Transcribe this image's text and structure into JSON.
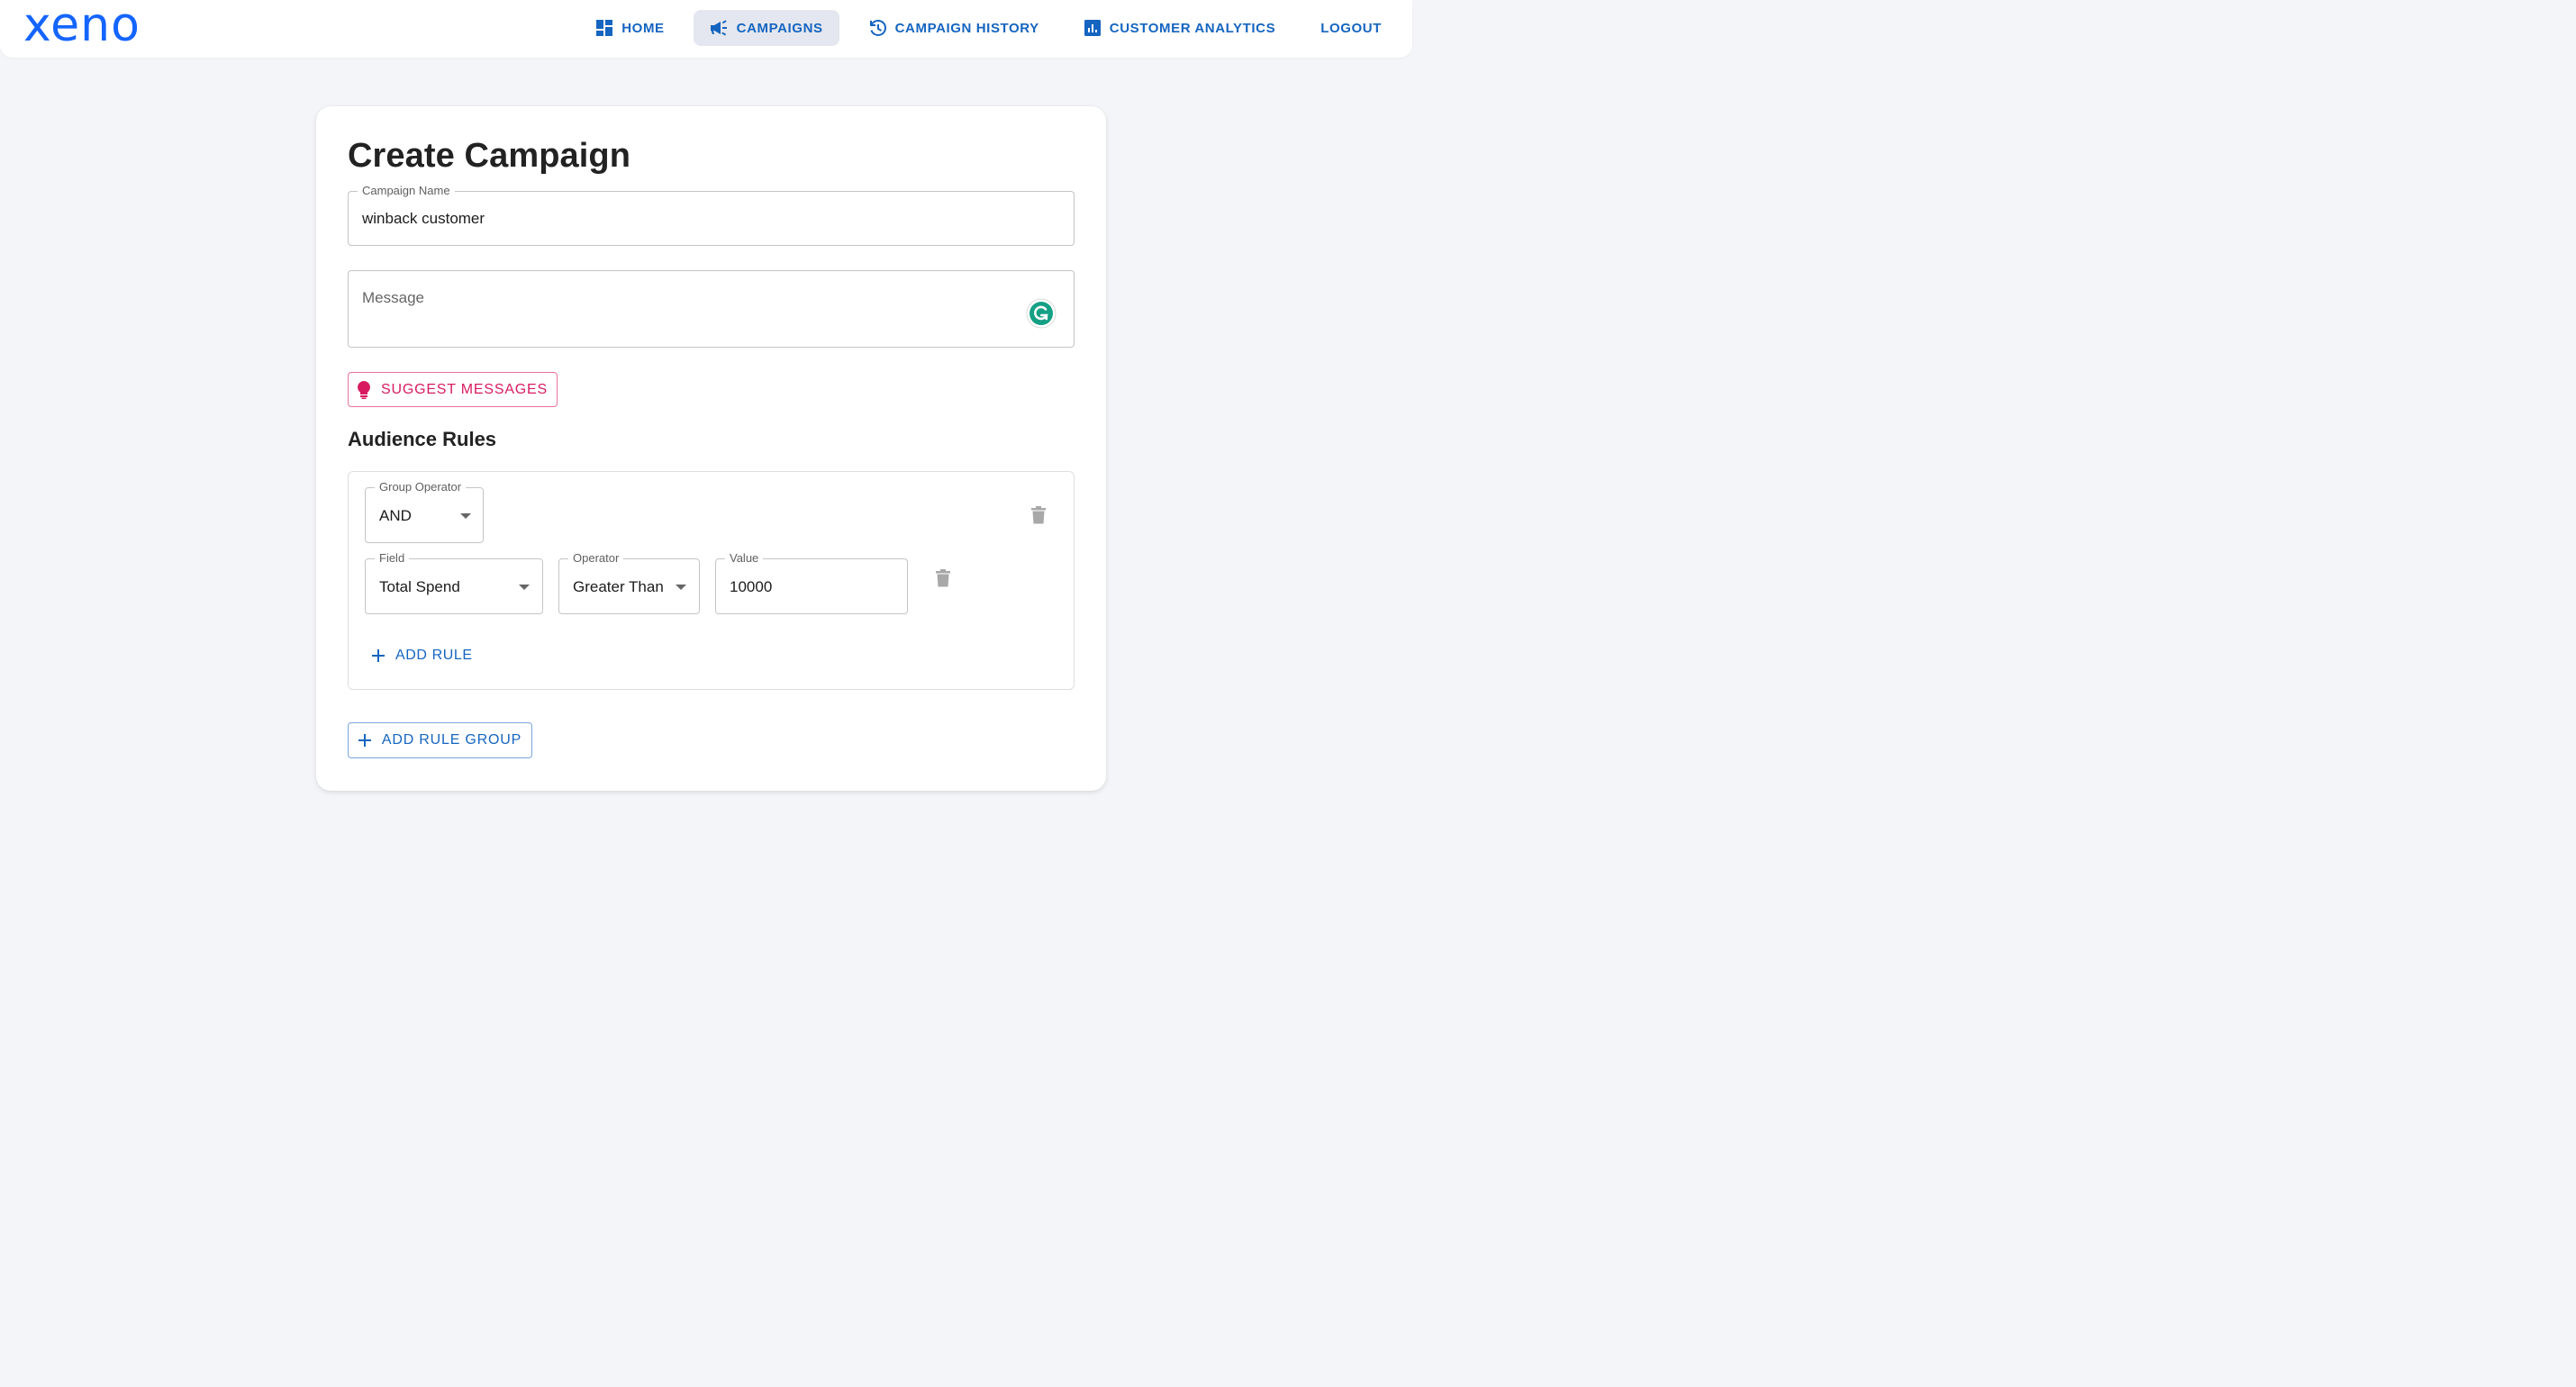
{
  "app": {
    "logo": "xeno",
    "brand_color": "#1565ff",
    "accent_color": "#1565c0"
  },
  "nav": {
    "items": [
      {
        "label": "HOME",
        "icon": "dashboard-icon",
        "active": false
      },
      {
        "label": "CAMPAIGNS",
        "icon": "campaign-megaphone-icon",
        "active": true
      },
      {
        "label": "CAMPAIGN HISTORY",
        "icon": "history-icon",
        "active": false
      },
      {
        "label": "CUSTOMER ANALYTICS",
        "icon": "analytics-icon",
        "active": false
      },
      {
        "label": "LOGOUT",
        "icon": null,
        "active": false
      }
    ]
  },
  "form": {
    "title": "Create Campaign",
    "campaign_name": {
      "label": "Campaign Name",
      "value": "winback customer"
    },
    "message": {
      "placeholder": "Message",
      "value": ""
    },
    "suggest_button": {
      "label": "SUGGEST MESSAGES",
      "icon": "lightbulb-icon",
      "color": "#d81b60"
    },
    "audience": {
      "title": "Audience Rules",
      "group": {
        "operator_label": "Group Operator",
        "operator_value": "AND",
        "rules": [
          {
            "field_label": "Field",
            "field_value": "Total Spend",
            "operator_label": "Operator",
            "operator_value": "Greater Than",
            "value_label": "Value",
            "value": "10000"
          }
        ],
        "add_rule_label": "ADD RULE"
      },
      "add_group_label": "ADD RULE GROUP"
    }
  }
}
